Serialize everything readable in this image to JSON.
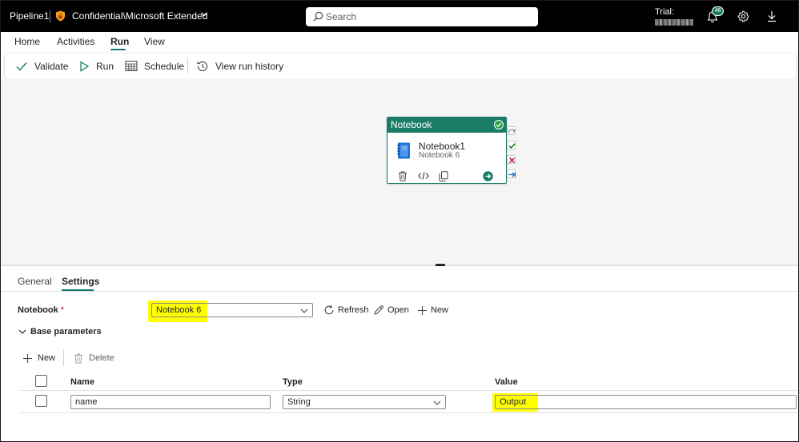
{
  "header": {
    "pipeline_title": "Pipeline1",
    "sensitivity_label": "Confidential\\Microsoft Extended",
    "search_placeholder": "Search",
    "trial_label": "Trial:",
    "notification_count": "46",
    "icons": [
      "shield-icon",
      "search-icon",
      "bell-icon",
      "gear-icon",
      "download-icon"
    ]
  },
  "ribbon": {
    "tabs": [
      {
        "label": "Home"
      },
      {
        "label": "Activities"
      },
      {
        "label": "Run",
        "active": true
      },
      {
        "label": "View"
      }
    ],
    "toolbar": {
      "validate": "Validate",
      "run": "Run",
      "schedule": "Schedule",
      "view_run_history": "View run history"
    }
  },
  "canvas": {
    "activity": {
      "type_label": "Notebook",
      "name": "Notebook1",
      "subtitle": "Notebook 6",
      "status": "succeeded",
      "accent_color": "#1a7c66"
    }
  },
  "settings_panel": {
    "tabs": [
      {
        "label": "General"
      },
      {
        "label": "Settings",
        "active": true
      }
    ],
    "notebook_label": "Notebook",
    "required_marker": "*",
    "notebook_value": "Notebook 6",
    "refresh": "Refresh",
    "open": "Open",
    "new": "New",
    "base_parameters_label": "Base parameters",
    "param_new": "New",
    "param_delete": "Delete",
    "columns": {
      "name": "Name",
      "type": "Type",
      "value": "Value"
    },
    "rows": [
      {
        "name": "name",
        "type": "String",
        "value": "Output"
      }
    ],
    "highlight_color": "#ffff00"
  }
}
